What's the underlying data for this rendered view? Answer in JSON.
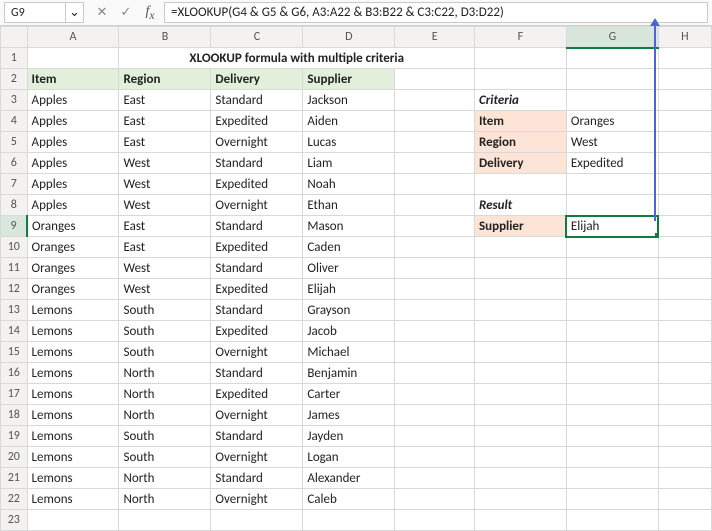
{
  "namebox": "G9",
  "formula": "=XLOOKUP(G4 & G5 & G6, A3:A22 & B3:B22 & C3:C22, D3:D22)",
  "title": "XLOOKUP formula with multiple criteria",
  "columns": [
    "A",
    "B",
    "C",
    "D",
    "E",
    "F",
    "G",
    "H"
  ],
  "rows": [
    "1",
    "2",
    "3",
    "4",
    "5",
    "6",
    "7",
    "8",
    "9",
    "10",
    "11",
    "12",
    "13",
    "14",
    "15",
    "16",
    "17",
    "18",
    "19",
    "20",
    "21",
    "22",
    "23"
  ],
  "table_headers": {
    "item": "Item",
    "region": "Region",
    "delivery": "Delivery",
    "supplier": "Supplier"
  },
  "tdata": [
    {
      "item": "Apples",
      "region": "East",
      "delivery": "Standard",
      "supplier": "Jackson"
    },
    {
      "item": "Apples",
      "region": "East",
      "delivery": "Expedited",
      "supplier": "Aiden"
    },
    {
      "item": "Apples",
      "region": "East",
      "delivery": "Overnight",
      "supplier": "Lucas"
    },
    {
      "item": "Apples",
      "region": "West",
      "delivery": "Standard",
      "supplier": "Liam"
    },
    {
      "item": "Apples",
      "region": "West",
      "delivery": "Expedited",
      "supplier": "Noah"
    },
    {
      "item": "Apples",
      "region": "West",
      "delivery": "Overnight",
      "supplier": "Ethan"
    },
    {
      "item": "Oranges",
      "region": "East",
      "delivery": "Standard",
      "supplier": "Mason"
    },
    {
      "item": "Oranges",
      "region": "East",
      "delivery": "Expedited",
      "supplier": "Caden"
    },
    {
      "item": "Oranges",
      "region": "West",
      "delivery": "Standard",
      "supplier": "Oliver"
    },
    {
      "item": "Oranges",
      "region": "West",
      "delivery": "Expedited",
      "supplier": "Elijah"
    },
    {
      "item": "Lemons",
      "region": "South",
      "delivery": "Standard",
      "supplier": "Grayson"
    },
    {
      "item": "Lemons",
      "region": "South",
      "delivery": "Expedited",
      "supplier": "Jacob"
    },
    {
      "item": "Lemons",
      "region": "South",
      "delivery": "Overnight",
      "supplier": "Michael"
    },
    {
      "item": "Lemons",
      "region": "North",
      "delivery": "Standard",
      "supplier": "Benjamin"
    },
    {
      "item": "Lemons",
      "region": "North",
      "delivery": "Expedited",
      "supplier": "Carter"
    },
    {
      "item": "Lemons",
      "region": "North",
      "delivery": "Overnight",
      "supplier": "James"
    },
    {
      "item": "Lemons",
      "region": "South",
      "delivery": "Standard",
      "supplier": "Jayden"
    },
    {
      "item": "Lemons",
      "region": "South",
      "delivery": "Overnight",
      "supplier": "Logan"
    },
    {
      "item": "Lemons",
      "region": "North",
      "delivery": "Standard",
      "supplier": "Alexander"
    },
    {
      "item": "Lemons",
      "region": "North",
      "delivery": "Overnight",
      "supplier": "Caleb"
    }
  ],
  "criteria": {
    "heading": "Criteria",
    "item_label": "Item",
    "item_value": "Oranges",
    "region_label": "Region",
    "region_value": "West",
    "delivery_label": "Delivery",
    "delivery_value": "Expedited"
  },
  "result": {
    "heading": "Result",
    "supplier_label": "Supplier",
    "supplier_value": "Elijah"
  },
  "icons": {
    "dropdown": "⌄",
    "cancel": "✕",
    "accept": "✓"
  }
}
